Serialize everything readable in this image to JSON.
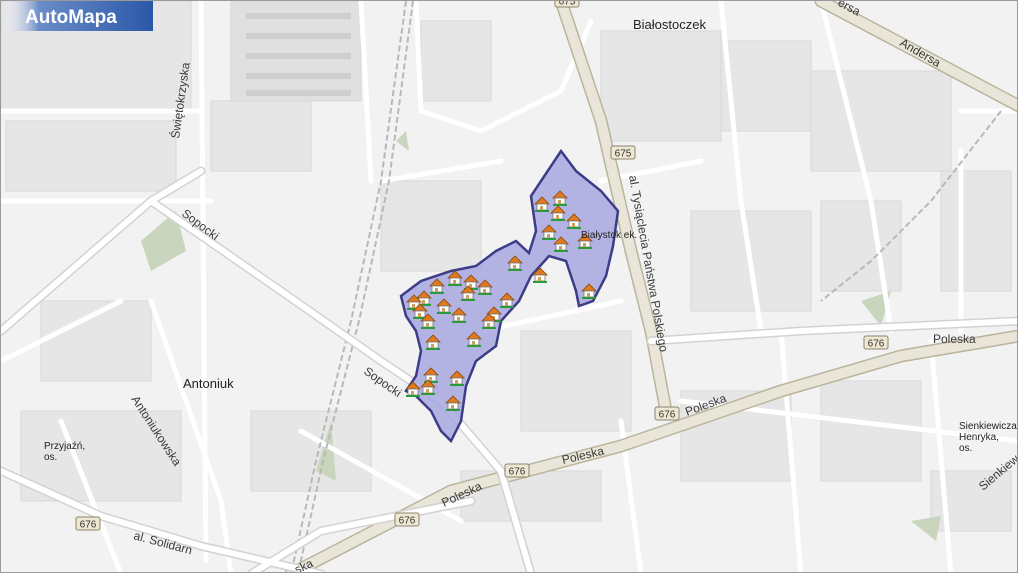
{
  "map": {
    "districts": [
      {
        "name": "Białostoczek",
        "size": "big"
      },
      {
        "name": "Antoniuk",
        "size": "big"
      },
      {
        "name": "Przyjaźń,",
        "line2": "os."
      },
      {
        "name": "Sienkiewicza",
        "line2": "Henryka,",
        "line3": "os."
      }
    ],
    "polygon_label": "Białystok ek.",
    "streets": {
      "swietokrzyska": "Świętokrzyska",
      "sopocki": "Sopocki",
      "sopocki2": "Sopocki",
      "antoniukowska": "Antoniukowska",
      "andersa": "Andersa",
      "andersa_top": "ersa",
      "tysiaclecia": "al. Tysiąclecia Państwa Polskiego",
      "poleska1": "Poleska",
      "poleska2": "Poleska",
      "poleska3": "Poleska",
      "poleska4": "Poleska",
      "solidarnosci": "al. Solidarn",
      "sienkiewicza_st": "Sienkiew",
      "bottom_cut": "ska"
    },
    "road_shields": [
      "676",
      "676",
      "676",
      "676",
      "676",
      "675",
      "675"
    ],
    "colors": {
      "background": "#f2f2f2",
      "block": "#e6e6e6",
      "road": "#ffffff",
      "road_casing": "#d2d2d2",
      "main_road": "#e9e6d9",
      "main_road_casing": "#b9b49c",
      "polygon_fill": "#a8a8e0",
      "polygon_stroke": "#3c3c88",
      "green": "#c9d6bd",
      "rail": "#b8b8b8"
    },
    "house_icon_count": 31
  },
  "brand": {
    "logo_text": "AutoMapa"
  }
}
